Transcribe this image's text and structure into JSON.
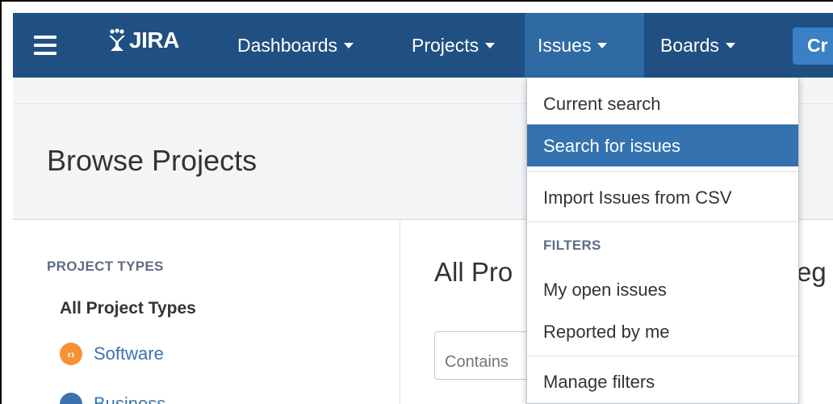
{
  "topbar": {
    "logo_text": "JIRA",
    "nav": [
      {
        "label": "Dashboards"
      },
      {
        "label": "Projects"
      },
      {
        "label": "Issues"
      },
      {
        "label": "Boards"
      }
    ],
    "create_label": "Cr",
    "bg_color": "#205081"
  },
  "page": {
    "title": "Browse Projects",
    "main_title_left": "All Pro",
    "main_title_right": "eg",
    "search_placeholder": "Contains"
  },
  "sidebar": {
    "heading": "PROJECT TYPES",
    "all_label": "All Project Types",
    "items": [
      {
        "label": "Software",
        "icon": "software-icon",
        "color": "#f79232"
      },
      {
        "label": "Business",
        "icon": "business-icon",
        "color": "#3b73af"
      }
    ]
  },
  "dropdown": {
    "items": [
      {
        "label": "Current search"
      },
      {
        "label": "Search for issues",
        "highlighted": true
      },
      {
        "label": "Import Issues from CSV"
      }
    ],
    "filters_heading": "FILTERS",
    "filter_items": [
      {
        "label": "My open issues"
      },
      {
        "label": "Reported by me"
      }
    ],
    "manage_label": "Manage filters"
  }
}
